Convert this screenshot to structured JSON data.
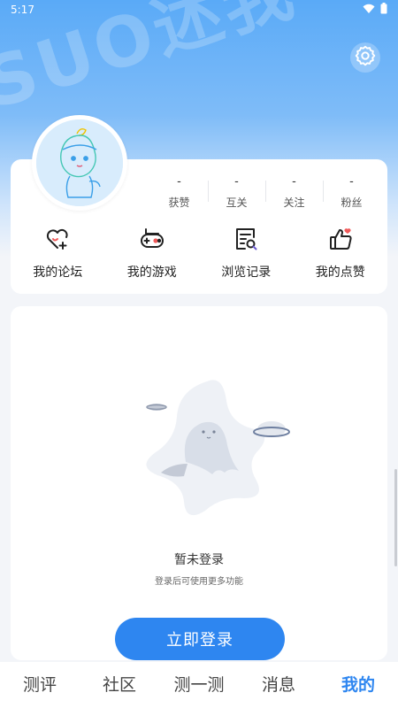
{
  "status_bar": {
    "time": "5:17",
    "wifi_icon": "wifi-icon",
    "battery_icon": "battery-icon"
  },
  "header": {
    "watermark_text": "SUO述我",
    "settings_icon": "gear-icon"
  },
  "profile": {
    "avatar_icon": "cartoon-avatar",
    "stats": [
      {
        "value": "-",
        "label": "获赞"
      },
      {
        "value": "-",
        "label": "互关"
      },
      {
        "value": "-",
        "label": "关注"
      },
      {
        "value": "-",
        "label": "粉丝"
      }
    ]
  },
  "shortcuts": [
    {
      "label": "我的论坛",
      "icon": "heart-plus-icon"
    },
    {
      "label": "我的游戏",
      "icon": "gamepad-icon"
    },
    {
      "label": "浏览记录",
      "icon": "history-search-icon"
    },
    {
      "label": "我的点赞",
      "icon": "thumbs-up-icon"
    }
  ],
  "empty_state": {
    "illustration": "ghost-space-illustration",
    "title": "暂未登录",
    "subtitle": "登录后可使用更多功能"
  },
  "login_button": "立即登录",
  "bottom_nav": [
    {
      "label": "测评",
      "active": false
    },
    {
      "label": "社区",
      "active": false
    },
    {
      "label": "测一测",
      "active": false
    },
    {
      "label": "消息",
      "active": false
    },
    {
      "label": "我的",
      "active": true
    }
  ],
  "colors": {
    "accent": "#2e86f0",
    "header_top": "#5aaaf7"
  }
}
